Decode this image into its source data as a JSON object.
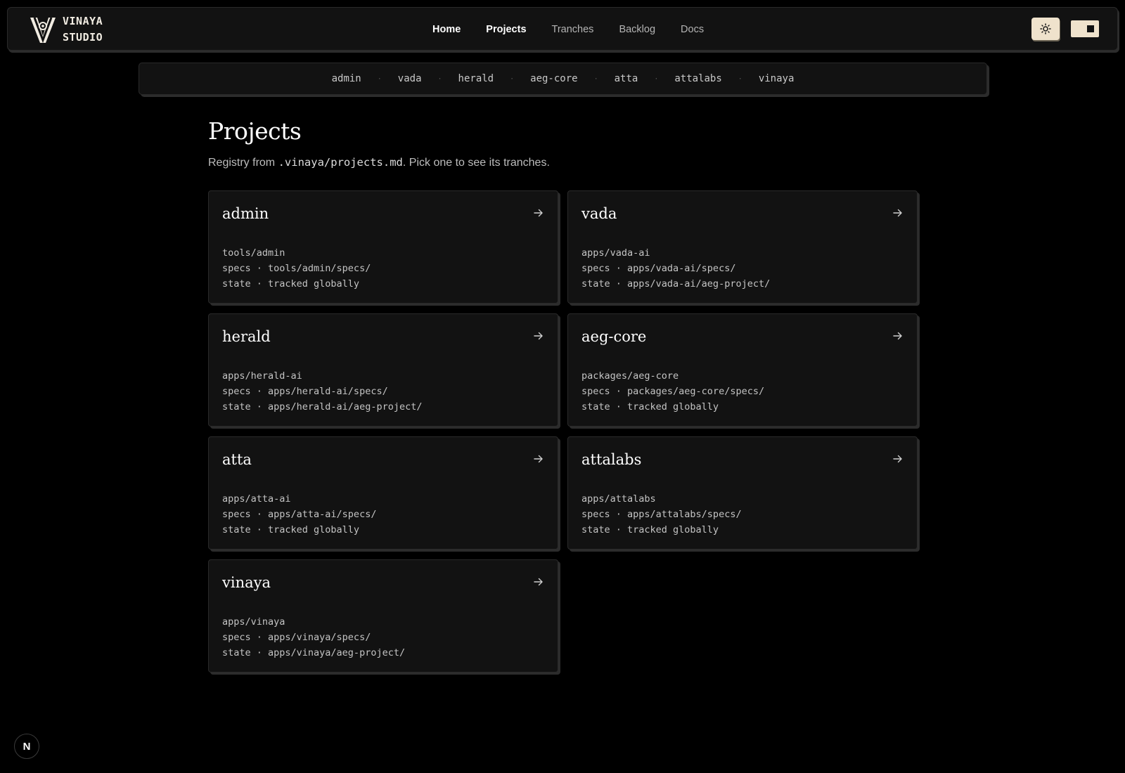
{
  "brand": {
    "line1": "VINAYA",
    "line2": "STUDIO"
  },
  "nav": [
    {
      "label": "Home",
      "active": false
    },
    {
      "label": "Projects",
      "active": true
    },
    {
      "label": "Tranches",
      "active": false
    },
    {
      "label": "Backlog",
      "active": false
    },
    {
      "label": "Docs",
      "active": false
    }
  ],
  "header_icons": {
    "theme": "sun-icon",
    "toggle": "theme-toggle",
    "accent": "#efe2cc"
  },
  "project_strip": [
    "admin",
    "vada",
    "herald",
    "aeg-core",
    "atta",
    "attalabs",
    "vinaya"
  ],
  "strip_separator": "·",
  "page": {
    "title": "Projects",
    "subtitle_before": "Registry from ",
    "subtitle_code": ".vinaya/projects.md",
    "subtitle_after": ". Pick one to see its tranches."
  },
  "projects": [
    {
      "name": "admin",
      "path": "tools/admin",
      "specs": "specs · tools/admin/specs/",
      "state": "state · tracked globally"
    },
    {
      "name": "vada",
      "path": "apps/vada-ai",
      "specs": "specs · apps/vada-ai/specs/",
      "state": "state · apps/vada-ai/aeg-project/"
    },
    {
      "name": "herald",
      "path": "apps/herald-ai",
      "specs": "specs · apps/herald-ai/specs/",
      "state": "state · apps/herald-ai/aeg-project/"
    },
    {
      "name": "aeg-core",
      "path": "packages/aeg-core",
      "specs": "specs · packages/aeg-core/specs/",
      "state": "state · tracked globally"
    },
    {
      "name": "atta",
      "path": "apps/atta-ai",
      "specs": "specs · apps/atta-ai/specs/",
      "state": "state · tracked globally"
    },
    {
      "name": "attalabs",
      "path": "apps/attalabs",
      "specs": "specs · apps/attalabs/specs/",
      "state": "state · tracked globally"
    },
    {
      "name": "vinaya",
      "path": "apps/vinaya",
      "specs": "specs · apps/vinaya/specs/",
      "state": "state · apps/vinaya/aeg-project/"
    }
  ],
  "dev_badge": {
    "label": "N",
    "icon": "nextjs-icon"
  }
}
